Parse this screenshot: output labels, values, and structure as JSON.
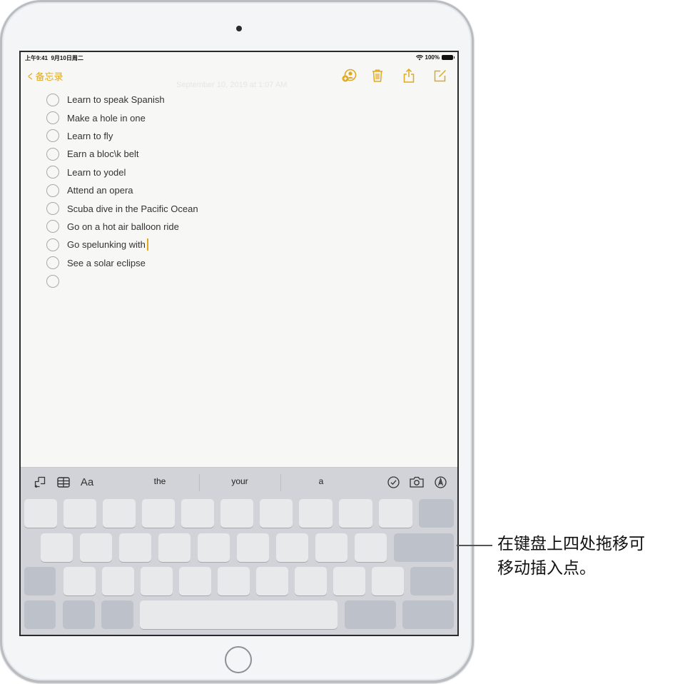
{
  "status_bar": {
    "time": "上午9:41",
    "date": "9月10日周二",
    "battery": "100%"
  },
  "nav": {
    "back_label": "备忘录",
    "faint_date": "September 10, 2019 at 1:07 AM",
    "icons": [
      "add-person-icon",
      "trash-icon",
      "share-icon",
      "compose-icon"
    ]
  },
  "checklist": [
    {
      "text": "Learn to speak Spanish",
      "checked": false
    },
    {
      "text": "Make a hole in one",
      "checked": false
    },
    {
      "text": "Learn to fly",
      "checked": false
    },
    {
      "text": "Earn a bloc\\k belt",
      "checked": false
    },
    {
      "text": "Learn to yodel",
      "checked": false
    },
    {
      "text": "Attend an opera",
      "checked": false
    },
    {
      "text": "Scuba dive in the Pacific Ocean",
      "checked": false
    },
    {
      "text": "Go on a hot air balloon ride",
      "checked": false
    },
    {
      "text": "Go spelunking with",
      "checked": false
    },
    {
      "text": "See a solar eclipse",
      "checked": false
    },
    {
      "text": "",
      "checked": false
    }
  ],
  "keyboard": {
    "shortcut_bar": {
      "left_icons": [
        "undo-icon",
        "table-icon",
        "format-text-icon"
      ],
      "format_label": "Aa",
      "suggestions": [
        "the",
        "your",
        "a"
      ],
      "right_icons": [
        "checklist-icon",
        "camera-icon",
        "markup-icon"
      ]
    }
  },
  "callout": {
    "line1": "在键盘上四处拖移可",
    "line2": "移动插入点。"
  },
  "colors": {
    "accent": "#e0a81e"
  }
}
